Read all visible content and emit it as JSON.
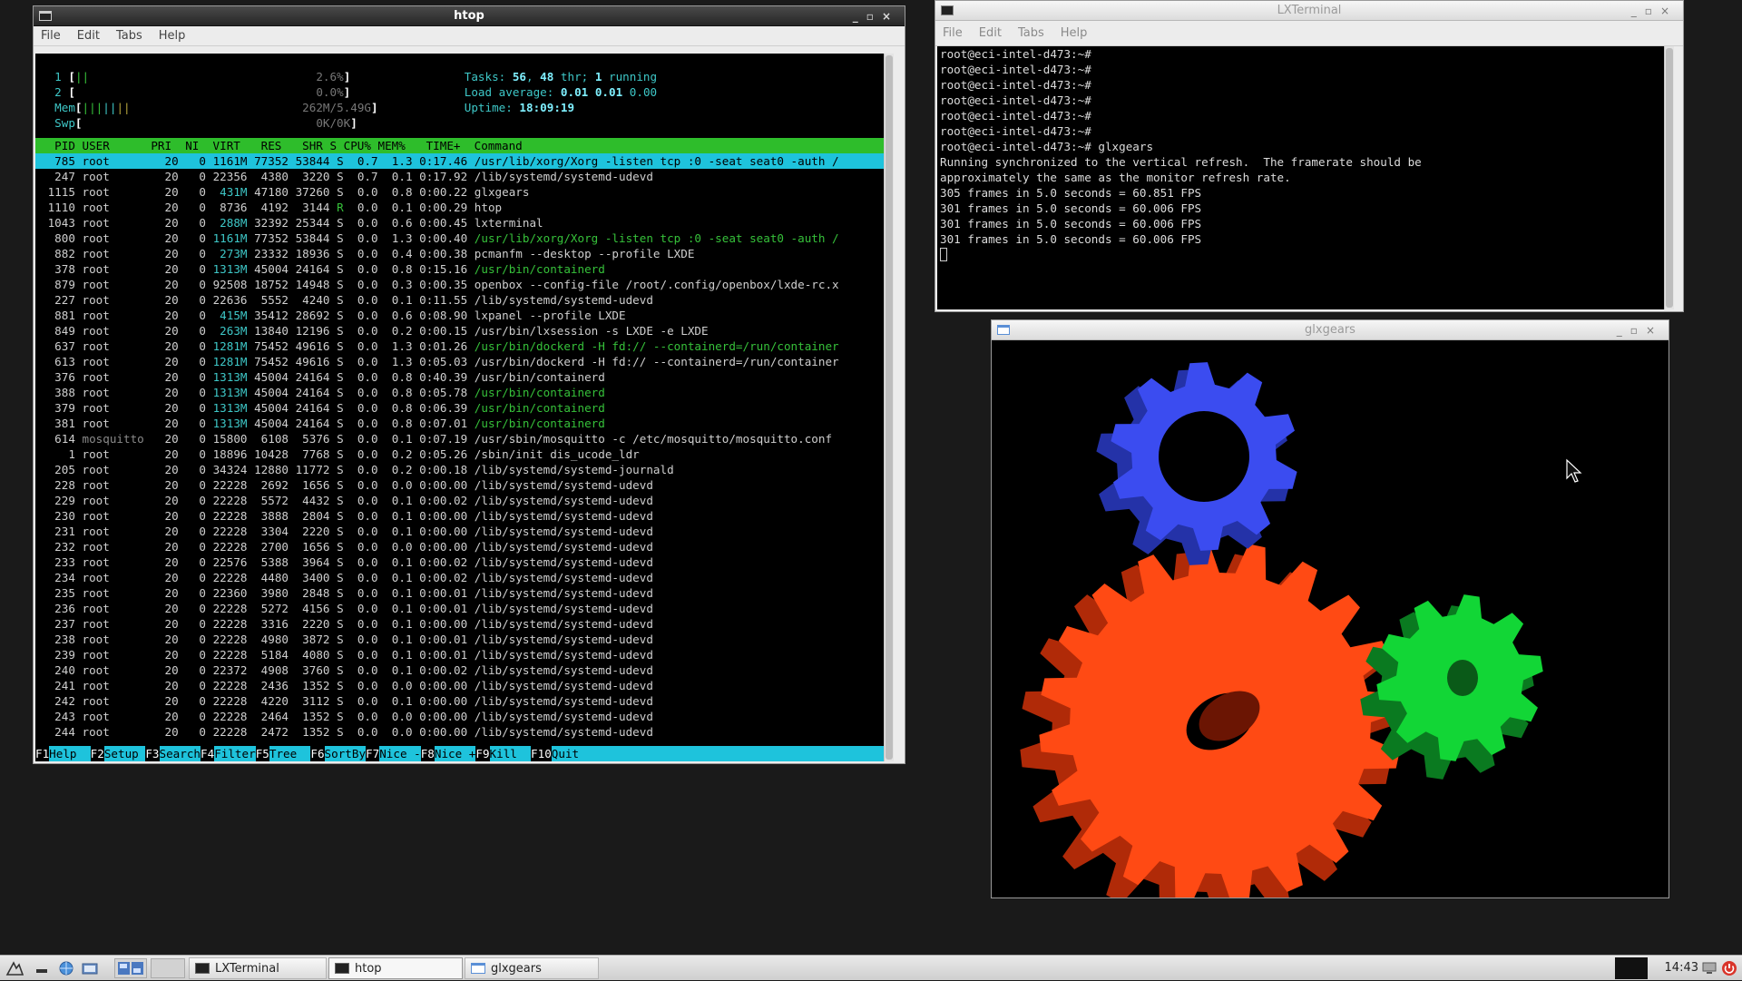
{
  "colors": {
    "htop_header_bg": "#2ebd2b",
    "htop_selected_bg": "#1ec3dc",
    "gear_red": "#ff4a14",
    "gear_green": "#12d636",
    "gear_blue": "#3b4cf0"
  },
  "htop": {
    "title": "htop",
    "menu": [
      "File",
      "Edit",
      "Tabs",
      "Help"
    ],
    "cpu1": {
      "num": "1",
      "bar": "||",
      "value": "2.6%"
    },
    "cpu2": {
      "num": "2",
      "bar": "",
      "value": "0.0%"
    },
    "mem": {
      "label": "Mem",
      "bar": "|||||||",
      "value": "262M/5.49G"
    },
    "swp": {
      "label": "Swp",
      "value": "0K/0K"
    },
    "tasks": {
      "label": "Tasks: ",
      "count": "56",
      "sep": ", ",
      "thr": "48",
      "thr_label": " thr; ",
      "running": "1",
      "running_label": " running"
    },
    "load": {
      "label": "Load average: ",
      "v1": "0.01",
      "v2": "0.01",
      "v3": "0.00"
    },
    "uptime": {
      "label": "Uptime: ",
      "value": "18:09:19"
    },
    "header": "  PID USER      PRI  NI  VIRT   RES   SHR S CPU% MEM%   TIME+  Command",
    "processes": [
      {
        "pid": "785",
        "user": "root",
        "pri": "20",
        "ni": "0",
        "virt": "1161M",
        "res": "77352",
        "shr": "53844",
        "s": "S",
        "cpu": "0.7",
        "mem": "1.3",
        "time": "0:17.46",
        "cmd": "/usr/lib/xorg/Xorg -listen tcp :0 -seat seat0 -auth /",
        "sel": true
      },
      {
        "pid": "247",
        "user": "root",
        "pri": "20",
        "ni": "0",
        "virt": "22356",
        "res": "4380",
        "shr": "3220",
        "s": "S",
        "cpu": "0.7",
        "mem": "0.1",
        "time": "0:17.92",
        "cmd": "/lib/systemd/systemd-udevd"
      },
      {
        "pid": "1115",
        "user": "root",
        "pri": "20",
        "ni": "0",
        "virt": "431M",
        "res": "47180",
        "shr": "37260",
        "s": "S",
        "cpu": "0.0",
        "mem": "0.8",
        "time": "0:00.22",
        "cmd": "glxgears"
      },
      {
        "pid": "1110",
        "user": "root",
        "pri": "20",
        "ni": "0",
        "virt": "8736",
        "res": "4192",
        "shr": "3144",
        "s": "R",
        "cpu": "0.0",
        "mem": "0.1",
        "time": "0:00.29",
        "cmd": "htop"
      },
      {
        "pid": "1043",
        "user": "root",
        "pri": "20",
        "ni": "0",
        "virt": "288M",
        "res": "32392",
        "shr": "25344",
        "s": "S",
        "cpu": "0.0",
        "mem": "0.6",
        "time": "0:00.45",
        "cmd": "lxterminal"
      },
      {
        "pid": "800",
        "user": "root",
        "pri": "20",
        "ni": "0",
        "virt": "1161M",
        "res": "77352",
        "shr": "53844",
        "s": "S",
        "cpu": "0.0",
        "mem": "1.3",
        "time": "0:00.40",
        "cmd": "/usr/lib/xorg/Xorg -listen tcp :0 -seat seat0 -auth /",
        "thread": true
      },
      {
        "pid": "882",
        "user": "root",
        "pri": "20",
        "ni": "0",
        "virt": "273M",
        "res": "23332",
        "shr": "18936",
        "s": "S",
        "cpu": "0.0",
        "mem": "0.4",
        "time": "0:00.38",
        "cmd": "pcmanfm --desktop --profile LXDE"
      },
      {
        "pid": "378",
        "user": "root",
        "pri": "20",
        "ni": "0",
        "virt": "1313M",
        "res": "45004",
        "shr": "24164",
        "s": "S",
        "cpu": "0.0",
        "mem": "0.8",
        "time": "0:15.16",
        "cmd": "/usr/bin/containerd",
        "thread": true
      },
      {
        "pid": "879",
        "user": "root",
        "pri": "20",
        "ni": "0",
        "virt": "92508",
        "res": "18752",
        "shr": "14948",
        "s": "S",
        "cpu": "0.0",
        "mem": "0.3",
        "time": "0:00.35",
        "cmd": "openbox --config-file /root/.config/openbox/lxde-rc.x"
      },
      {
        "pid": "227",
        "user": "root",
        "pri": "20",
        "ni": "0",
        "virt": "22636",
        "res": "5552",
        "shr": "4240",
        "s": "S",
        "cpu": "0.0",
        "mem": "0.1",
        "time": "0:11.55",
        "cmd": "/lib/systemd/systemd-udevd"
      },
      {
        "pid": "881",
        "user": "root",
        "pri": "20",
        "ni": "0",
        "virt": "415M",
        "res": "35412",
        "shr": "28692",
        "s": "S",
        "cpu": "0.0",
        "mem": "0.6",
        "time": "0:08.90",
        "cmd": "lxpanel --profile LXDE"
      },
      {
        "pid": "849",
        "user": "root",
        "pri": "20",
        "ni": "0",
        "virt": "263M",
        "res": "13840",
        "shr": "12196",
        "s": "S",
        "cpu": "0.0",
        "mem": "0.2",
        "time": "0:00.15",
        "cmd": "/usr/bin/lxsession -s LXDE -e LXDE"
      },
      {
        "pid": "637",
        "user": "root",
        "pri": "20",
        "ni": "0",
        "virt": "1281M",
        "res": "75452",
        "shr": "49616",
        "s": "S",
        "cpu": "0.0",
        "mem": "1.3",
        "time": "0:01.26",
        "cmd": "/usr/bin/dockerd -H fd:// --containerd=/run/container",
        "thread": true
      },
      {
        "pid": "613",
        "user": "root",
        "pri": "20",
        "ni": "0",
        "virt": "1281M",
        "res": "75452",
        "shr": "49616",
        "s": "S",
        "cpu": "0.0",
        "mem": "1.3",
        "time": "0:05.03",
        "cmd": "/usr/bin/dockerd -H fd:// --containerd=/run/container"
      },
      {
        "pid": "376",
        "user": "root",
        "pri": "20",
        "ni": "0",
        "virt": "1313M",
        "res": "45004",
        "shr": "24164",
        "s": "S",
        "cpu": "0.0",
        "mem": "0.8",
        "time": "0:40.39",
        "cmd": "/usr/bin/containerd"
      },
      {
        "pid": "388",
        "user": "root",
        "pri": "20",
        "ni": "0",
        "virt": "1313M",
        "res": "45004",
        "shr": "24164",
        "s": "S",
        "cpu": "0.0",
        "mem": "0.8",
        "time": "0:05.78",
        "cmd": "/usr/bin/containerd",
        "thread": true
      },
      {
        "pid": "379",
        "user": "root",
        "pri": "20",
        "ni": "0",
        "virt": "1313M",
        "res": "45004",
        "shr": "24164",
        "s": "S",
        "cpu": "0.0",
        "mem": "0.8",
        "time": "0:06.39",
        "cmd": "/usr/bin/containerd",
        "thread": true
      },
      {
        "pid": "381",
        "user": "root",
        "pri": "20",
        "ni": "0",
        "virt": "1313M",
        "res": "45004",
        "shr": "24164",
        "s": "S",
        "cpu": "0.0",
        "mem": "0.8",
        "time": "0:07.01",
        "cmd": "/usr/bin/containerd",
        "thread": true
      },
      {
        "pid": "614",
        "user": "mosquitto",
        "pri": "20",
        "ni": "0",
        "virt": "15800",
        "res": "6108",
        "shr": "5376",
        "s": "S",
        "cpu": "0.0",
        "mem": "0.1",
        "time": "0:07.19",
        "cmd": "/usr/sbin/mosquitto -c /etc/mosquitto/mosquitto.conf"
      },
      {
        "pid": "1",
        "user": "root",
        "pri": "20",
        "ni": "0",
        "virt": "18896",
        "res": "10428",
        "shr": "7768",
        "s": "S",
        "cpu": "0.0",
        "mem": "0.2",
        "time": "0:05.26",
        "cmd": "/sbin/init dis_ucode_ldr"
      },
      {
        "pid": "205",
        "user": "root",
        "pri": "20",
        "ni": "0",
        "virt": "34324",
        "res": "12880",
        "shr": "11772",
        "s": "S",
        "cpu": "0.0",
        "mem": "0.2",
        "time": "0:00.18",
        "cmd": "/lib/systemd/systemd-journald"
      },
      {
        "pid": "228",
        "user": "root",
        "pri": "20",
        "ni": "0",
        "virt": "22228",
        "res": "2692",
        "shr": "1656",
        "s": "S",
        "cpu": "0.0",
        "mem": "0.0",
        "time": "0:00.00",
        "cmd": "/lib/systemd/systemd-udevd"
      },
      {
        "pid": "229",
        "user": "root",
        "pri": "20",
        "ni": "0",
        "virt": "22228",
        "res": "5572",
        "shr": "4432",
        "s": "S",
        "cpu": "0.0",
        "mem": "0.1",
        "time": "0:00.02",
        "cmd": "/lib/systemd/systemd-udevd"
      },
      {
        "pid": "230",
        "user": "root",
        "pri": "20",
        "ni": "0",
        "virt": "22228",
        "res": "3888",
        "shr": "2804",
        "s": "S",
        "cpu": "0.0",
        "mem": "0.1",
        "time": "0:00.00",
        "cmd": "/lib/systemd/systemd-udevd"
      },
      {
        "pid": "231",
        "user": "root",
        "pri": "20",
        "ni": "0",
        "virt": "22228",
        "res": "3304",
        "shr": "2220",
        "s": "S",
        "cpu": "0.0",
        "mem": "0.1",
        "time": "0:00.00",
        "cmd": "/lib/systemd/systemd-udevd"
      },
      {
        "pid": "232",
        "user": "root",
        "pri": "20",
        "ni": "0",
        "virt": "22228",
        "res": "2700",
        "shr": "1656",
        "s": "S",
        "cpu": "0.0",
        "mem": "0.0",
        "time": "0:00.00",
        "cmd": "/lib/systemd/systemd-udevd"
      },
      {
        "pid": "233",
        "user": "root",
        "pri": "20",
        "ni": "0",
        "virt": "22576",
        "res": "5388",
        "shr": "3964",
        "s": "S",
        "cpu": "0.0",
        "mem": "0.1",
        "time": "0:00.02",
        "cmd": "/lib/systemd/systemd-udevd"
      },
      {
        "pid": "234",
        "user": "root",
        "pri": "20",
        "ni": "0",
        "virt": "22228",
        "res": "4480",
        "shr": "3400",
        "s": "S",
        "cpu": "0.0",
        "mem": "0.1",
        "time": "0:00.02",
        "cmd": "/lib/systemd/systemd-udevd"
      },
      {
        "pid": "235",
        "user": "root",
        "pri": "20",
        "ni": "0",
        "virt": "22360",
        "res": "3980",
        "shr": "2848",
        "s": "S",
        "cpu": "0.0",
        "mem": "0.1",
        "time": "0:00.01",
        "cmd": "/lib/systemd/systemd-udevd"
      },
      {
        "pid": "236",
        "user": "root",
        "pri": "20",
        "ni": "0",
        "virt": "22228",
        "res": "5272",
        "shr": "4156",
        "s": "S",
        "cpu": "0.0",
        "mem": "0.1",
        "time": "0:00.01",
        "cmd": "/lib/systemd/systemd-udevd"
      },
      {
        "pid": "237",
        "user": "root",
        "pri": "20",
        "ni": "0",
        "virt": "22228",
        "res": "3316",
        "shr": "2220",
        "s": "S",
        "cpu": "0.0",
        "mem": "0.1",
        "time": "0:00.00",
        "cmd": "/lib/systemd/systemd-udevd"
      },
      {
        "pid": "238",
        "user": "root",
        "pri": "20",
        "ni": "0",
        "virt": "22228",
        "res": "4980",
        "shr": "3872",
        "s": "S",
        "cpu": "0.0",
        "mem": "0.1",
        "time": "0:00.01",
        "cmd": "/lib/systemd/systemd-udevd"
      },
      {
        "pid": "239",
        "user": "root",
        "pri": "20",
        "ni": "0",
        "virt": "22228",
        "res": "5184",
        "shr": "4080",
        "s": "S",
        "cpu": "0.0",
        "mem": "0.1",
        "time": "0:00.01",
        "cmd": "/lib/systemd/systemd-udevd"
      },
      {
        "pid": "240",
        "user": "root",
        "pri": "20",
        "ni": "0",
        "virt": "22372",
        "res": "4908",
        "shr": "3760",
        "s": "S",
        "cpu": "0.0",
        "mem": "0.1",
        "time": "0:00.02",
        "cmd": "/lib/systemd/systemd-udevd"
      },
      {
        "pid": "241",
        "user": "root",
        "pri": "20",
        "ni": "0",
        "virt": "22228",
        "res": "2436",
        "shr": "1352",
        "s": "S",
        "cpu": "0.0",
        "mem": "0.0",
        "time": "0:00.00",
        "cmd": "/lib/systemd/systemd-udevd"
      },
      {
        "pid": "242",
        "user": "root",
        "pri": "20",
        "ni": "0",
        "virt": "22228",
        "res": "4220",
        "shr": "3112",
        "s": "S",
        "cpu": "0.0",
        "mem": "0.1",
        "time": "0:00.00",
        "cmd": "/lib/systemd/systemd-udevd"
      },
      {
        "pid": "243",
        "user": "root",
        "pri": "20",
        "ni": "0",
        "virt": "22228",
        "res": "2464",
        "shr": "1352",
        "s": "S",
        "cpu": "0.0",
        "mem": "0.0",
        "time": "0:00.00",
        "cmd": "/lib/systemd/systemd-udevd"
      },
      {
        "pid": "244",
        "user": "root",
        "pri": "20",
        "ni": "0",
        "virt": "22228",
        "res": "2472",
        "shr": "1352",
        "s": "S",
        "cpu": "0.0",
        "mem": "0.0",
        "time": "0:00.00",
        "cmd": "/lib/systemd/systemd-udevd"
      }
    ],
    "fkeys": [
      {
        "key": "F1",
        "label": "Help  "
      },
      {
        "key": "F2",
        "label": "Setup "
      },
      {
        "key": "F3",
        "label": "Search"
      },
      {
        "key": "F4",
        "label": "Filter"
      },
      {
        "key": "F5",
        "label": "Tree  "
      },
      {
        "key": "F6",
        "label": "SortBy"
      },
      {
        "key": "F7",
        "label": "Nice -"
      },
      {
        "key": "F8",
        "label": "Nice +"
      },
      {
        "key": "F9",
        "label": "Kill  "
      },
      {
        "key": "F10",
        "label": "Quit  "
      }
    ]
  },
  "lxterminal": {
    "title": "LXTerminal",
    "menu": [
      "File",
      "Edit",
      "Tabs",
      "Help"
    ],
    "lines": [
      "root@eci-intel-d473:~#",
      "root@eci-intel-d473:~#",
      "root@eci-intel-d473:~#",
      "root@eci-intel-d473:~#",
      "root@eci-intel-d473:~#",
      "root@eci-intel-d473:~#",
      "root@eci-intel-d473:~# glxgears",
      "Running synchronized to the vertical refresh.  The framerate should be",
      "approximately the same as the monitor refresh rate.",
      "305 frames in 5.0 seconds = 60.851 FPS",
      "301 frames in 5.0 seconds = 60.006 FPS",
      "301 frames in 5.0 seconds = 60.006 FPS",
      "301 frames in 5.0 seconds = 60.006 FPS"
    ]
  },
  "glxgears": {
    "title": "glxgears"
  },
  "taskbar": {
    "tasks": [
      {
        "label": "LXTerminal"
      },
      {
        "label": "htop"
      },
      {
        "label": "glxgears"
      }
    ],
    "clock": "14:43"
  }
}
